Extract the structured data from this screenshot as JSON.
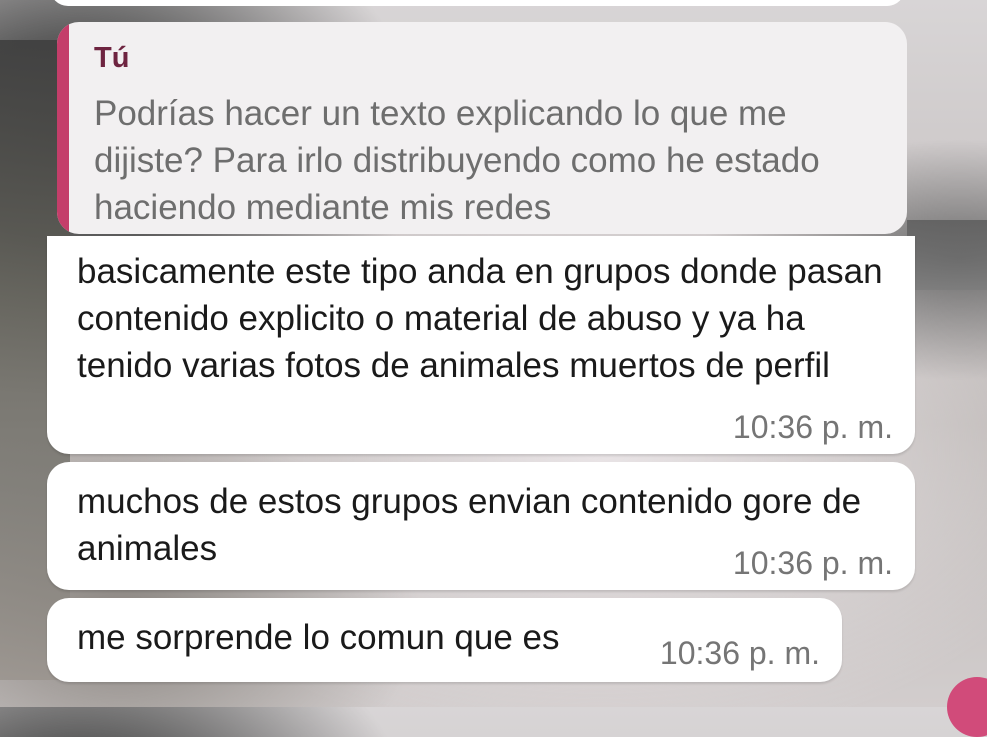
{
  "quoted": {
    "sender": "Tú",
    "text": "Podrías hacer un texto explicando lo que me dijiste? Para irlo distribuyendo como he estado haciendo mediante mis redes"
  },
  "messages": [
    {
      "text": "basicamente este tipo anda en grupos donde pasan contenido explicito o material de abuso y ya ha tenido varias fotos de animales muertos de perfil",
      "time": "10:36 p. m."
    },
    {
      "text": "muchos de estos grupos envian contenido gore de animales",
      "time": "10:36 p. m."
    },
    {
      "text": "me sorprende lo comun que es",
      "time": "10:36 p. m."
    }
  ],
  "colors": {
    "quote_bar": "#c43e6a",
    "quote_sender": "#6e2440",
    "bubble_bg": "#ffffff",
    "quote_bg": "#f2f0f1"
  }
}
